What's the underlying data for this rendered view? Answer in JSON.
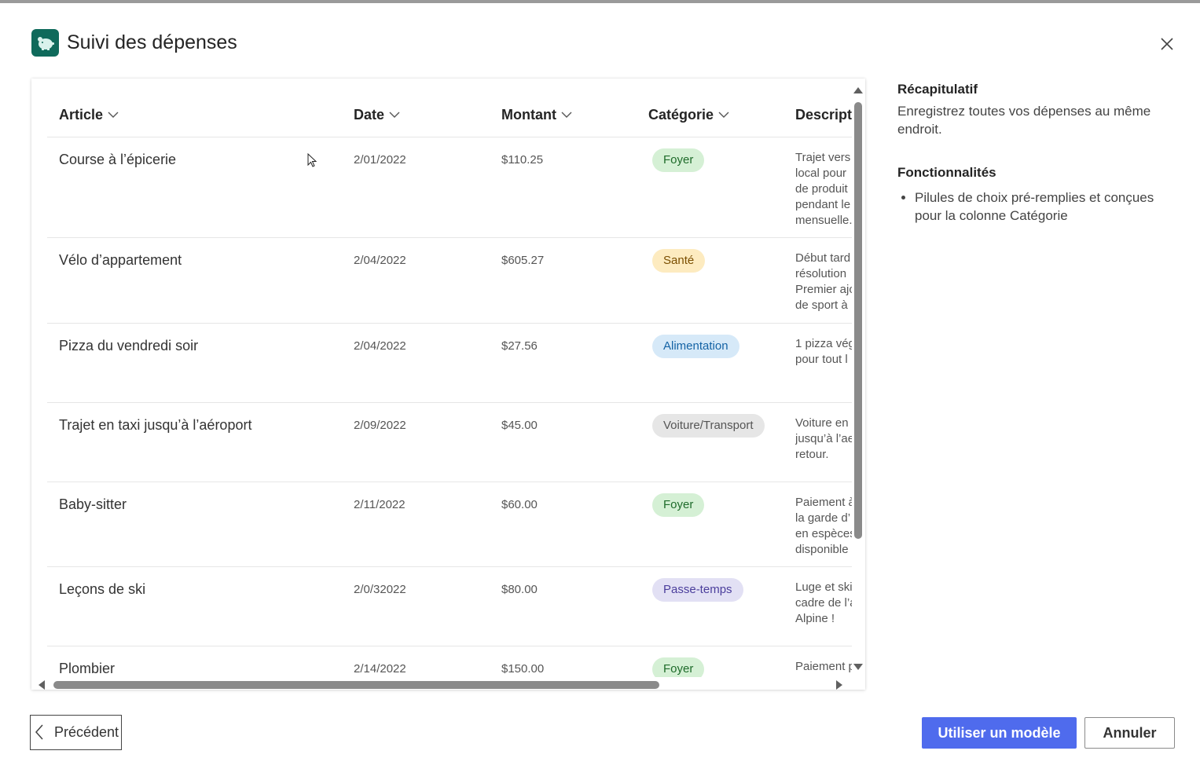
{
  "dialog": {
    "title": "Suivi des dépenses",
    "app_icon": "piggy-bank-icon",
    "close_icon": "close-icon"
  },
  "table": {
    "columns": [
      {
        "label": "Article"
      },
      {
        "label": "Date"
      },
      {
        "label": "Montant"
      },
      {
        "label": "Catégorie"
      },
      {
        "label": "Descripti"
      }
    ],
    "rows": [
      {
        "article": "Course à l’épicerie",
        "date": "2/01/2022",
        "amount": "$110.25",
        "category": "Foyer",
        "desc": [
          "Trajet vers",
          "local pour",
          "de produit",
          "pendant le",
          "mensuelle."
        ]
      },
      {
        "article": "Vélo d’appartement",
        "date": "2/04/2022",
        "amount": "$605.27",
        "category": "Santé",
        "desc": [
          "Début tard",
          "résolution",
          "Premier ajo",
          "de sport à"
        ]
      },
      {
        "article": "Pizza du vendredi soir",
        "date": "2/04/2022",
        "amount": "$27.56",
        "category": "Alimentation",
        "desc": [
          "1 pizza vég",
          "pour tout l"
        ]
      },
      {
        "article": "Trajet en taxi jusqu’à l’aéroport",
        "date": "2/09/2022",
        "amount": "$45.00",
        "category": "Voiture/Transport",
        "desc": [
          "Voiture en",
          "jusqu’à l’ae",
          "retour."
        ]
      },
      {
        "article": "Baby-sitter",
        "date": "2/11/2022",
        "amount": "$60.00",
        "category": "Foyer",
        "desc": [
          "Paiement à",
          "la garde d’",
          "en espèces",
          "disponible"
        ]
      },
      {
        "article": "Leçons de ski",
        "date": "2/0/32022",
        "amount": "$80.00",
        "category": "Passe-temps",
        "desc": [
          "Luge et ski",
          "cadre de l’a",
          "Alpine !"
        ]
      },
      {
        "article": "Plombier",
        "date": "2/14/2022",
        "amount": "$150.00",
        "category": "Foyer",
        "desc": [
          "Paiement p"
        ]
      }
    ],
    "category_colors": {
      "Foyer": {
        "bg": "#d5f0d5",
        "fg": "#1e6b2a"
      },
      "Santé": {
        "bg": "#fdebc0",
        "fg": "#7a4e00"
      },
      "Alimentation": {
        "bg": "#d6e9f8",
        "fg": "#1463a5"
      },
      "Voiture/Transport": {
        "bg": "#e6e6e6",
        "fg": "#555555"
      },
      "Passe-temps": {
        "bg": "#e2e0f4",
        "fg": "#4b3e9c"
      }
    }
  },
  "sidebar": {
    "summary_heading": "Récapitulatif",
    "summary_text": "Enregistrez toutes vos dépenses au même endroit.",
    "features_heading": "Fonctionnalités",
    "features": [
      "Pilules de choix pré-remplies et conçues pour la colonne Catégorie"
    ]
  },
  "footer": {
    "prev_label": "Précédent",
    "use_template_label": "Utiliser un modèle",
    "cancel_label": "Annuler"
  },
  "colors": {
    "primary": "#4f6bed",
    "app_icon_bg": "#0f6a5b"
  }
}
